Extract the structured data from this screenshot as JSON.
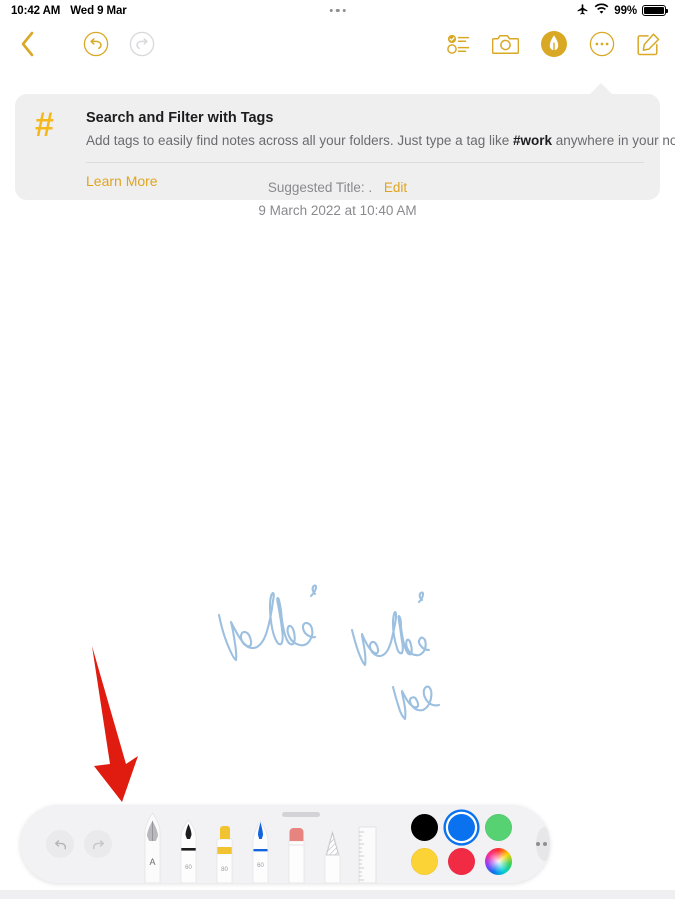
{
  "status_bar": {
    "time": "10:42 AM",
    "date": "Wed 9 Mar",
    "battery_percent": "99%",
    "airplane_icon": "airplane-icon",
    "wifi_icon": "wifi-icon",
    "battery_icon": "battery-icon",
    "center_indicator": "dynamic-dots"
  },
  "nav_toolbar": {
    "back_label": "back-chevron",
    "undo_label": "undo",
    "redo_label": "redo",
    "checklist_label": "checklist",
    "camera_label": "camera",
    "markup_label": "markup",
    "more_label": "more",
    "compose_label": "compose",
    "accent_color": "#d9a825",
    "disabled_color": "#d5d5d8"
  },
  "banner": {
    "icon": "hashtag-icon",
    "title": "Search and Filter with Tags",
    "body_before": "Add tags to easily find notes across all your folders. Just type a tag like ",
    "body_tag": "#work",
    "body_after": " anywhere in your note.",
    "learn_more": "Learn More",
    "close_label": "close",
    "background": "#efeff0",
    "icon_color": "#f5b81c",
    "link_color": "#e0a51f"
  },
  "note": {
    "suggested_title_label": "Suggested Title: .",
    "edit_link": "Edit",
    "date": "9 March 2022 at 10:40 AM",
    "ink_color": "#9dc0e0"
  },
  "handwriting": {
    "word_1": "hello",
    "word_2": "hello",
    "word_3": "ho"
  },
  "annotation": {
    "arrow_label": "red-pointer-arrow",
    "color": "#e01b0f"
  },
  "markup_toolbar": {
    "undo_label": "undo",
    "redo_label": "redo",
    "grab_handle_label": "drag-handle",
    "more_label": "more-options",
    "background": "#f2f2f4",
    "tools": [
      {
        "name": "pen",
        "label": "A",
        "selected": true
      },
      {
        "name": "felt-tip-pen",
        "label": "60",
        "selected": false
      },
      {
        "name": "highlighter",
        "label": "80",
        "selected": false
      },
      {
        "name": "fountain-pen",
        "label": "60",
        "selected": false
      },
      {
        "name": "eraser",
        "label": "",
        "selected": false
      },
      {
        "name": "lasso-select",
        "label": "",
        "selected": false
      },
      {
        "name": "ruler",
        "label": "",
        "selected": false
      }
    ],
    "colors": [
      {
        "name": "black",
        "hex": "#000000",
        "selected": false
      },
      {
        "name": "blue",
        "hex": "#0a72ef",
        "selected": true
      },
      {
        "name": "green",
        "hex": "#56d273",
        "selected": false
      },
      {
        "name": "yellow",
        "hex": "#fcd337",
        "selected": false
      },
      {
        "name": "red",
        "hex": "#f22b45",
        "selected": false
      },
      {
        "name": "spectrum",
        "hex": "spectrum",
        "selected": false
      }
    ]
  }
}
